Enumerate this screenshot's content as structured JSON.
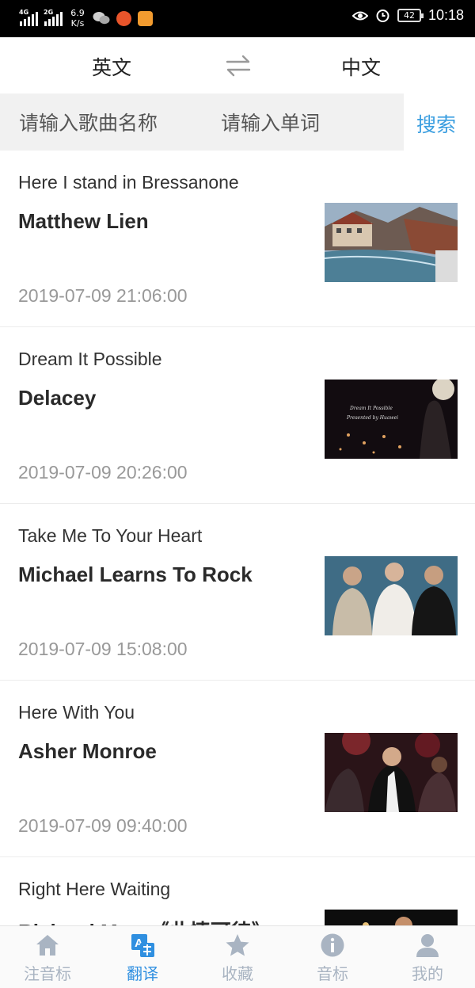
{
  "status_bar": {
    "network_1": "4G",
    "network_2": "2G",
    "speed_value": "6.9",
    "speed_unit": "K/s",
    "battery": "42",
    "time": "10:18"
  },
  "lang_switch": {
    "source": "英文",
    "target": "中文",
    "swap_icon": "swap-arrows-icon"
  },
  "search": {
    "song_placeholder": "请输入歌曲名称",
    "word_placeholder": "请输入单词",
    "button_label": "搜索"
  },
  "songs": [
    {
      "title": "Here I stand in Bressanone",
      "artist": "Matthew Lien",
      "date": "2019-07-09 21:06:00"
    },
    {
      "title": "Dream It Possible",
      "artist": "Delacey",
      "date": "2019-07-09 20:26:00",
      "thumb_text_1": "Dream It Possible",
      "thumb_text_2": "Presented by Huawei"
    },
    {
      "title": "Take Me To Your Heart",
      "artist": "Michael Learns To Rock",
      "date": "2019-07-09 15:08:00"
    },
    {
      "title": "Here With You",
      "artist": "Asher Monroe",
      "date": "2019-07-09 09:40:00"
    },
    {
      "title": "Right Here Waiting",
      "artist": "Richard Marx《此情可待》",
      "date": ""
    }
  ],
  "tabs": [
    {
      "label": "注音标",
      "icon": "home-icon",
      "active": false
    },
    {
      "label": "翻译",
      "icon": "translate-icon",
      "active": true
    },
    {
      "label": "收藏",
      "icon": "star-icon",
      "active": false
    },
    {
      "label": "音标",
      "icon": "info-icon",
      "active": false
    },
    {
      "label": "我的",
      "icon": "user-icon",
      "active": false
    }
  ],
  "colors": {
    "accent": "#2f8fe0",
    "search_button": "#3a9ee0",
    "tab_inactive": "#a9b4c2",
    "date_text": "#999999",
    "search_bg": "#f1f1f1"
  }
}
